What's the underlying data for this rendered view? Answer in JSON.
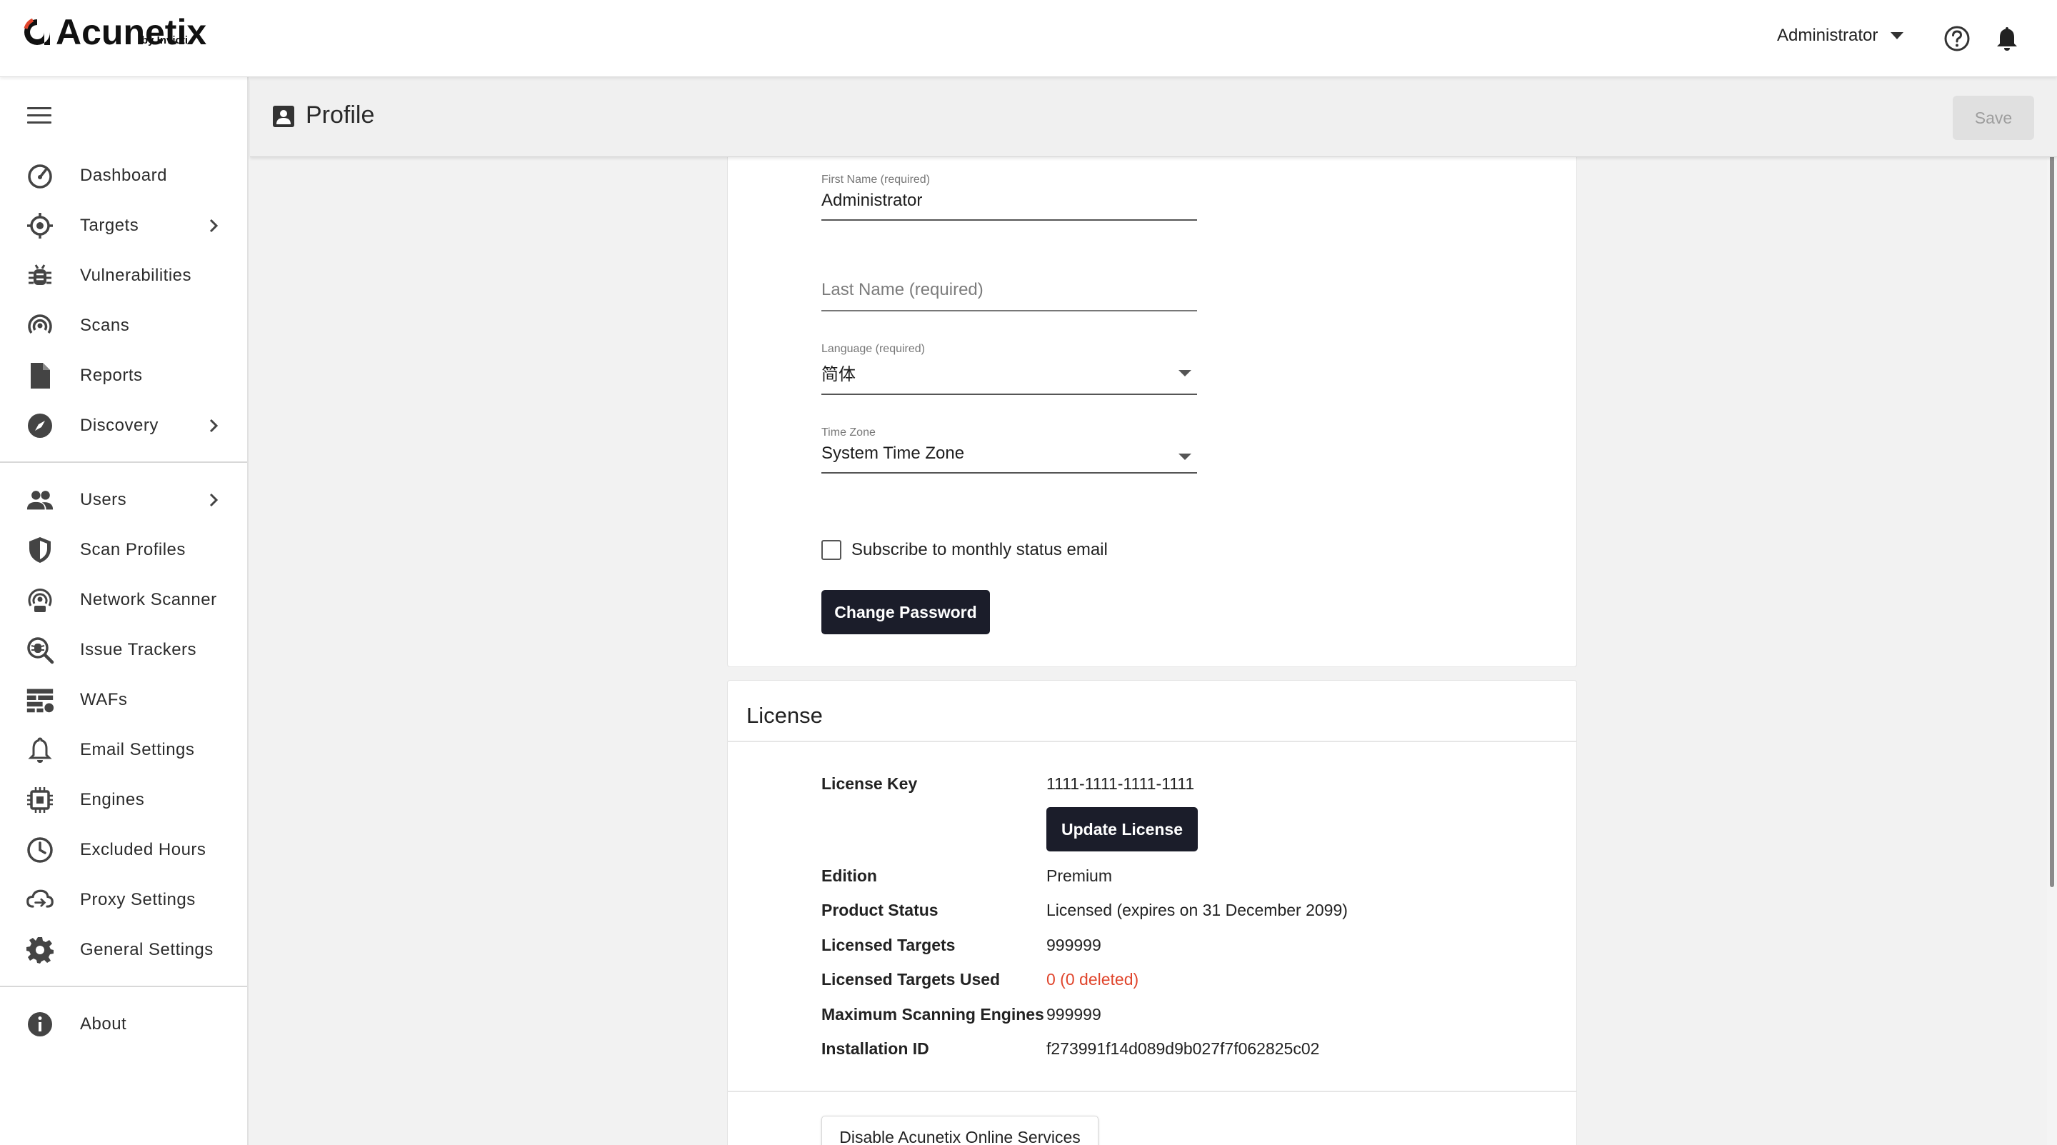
{
  "brand": {
    "name": "Acunetix",
    "sub": "by Invicti",
    "accent": "#e0452c"
  },
  "topbar": {
    "user_label": "Administrator"
  },
  "sidebar": {
    "items": [
      {
        "label": "Dashboard",
        "icon": "dashboard-icon"
      },
      {
        "label": "Targets",
        "icon": "target-icon"
      },
      {
        "label": "Vulnerabilities",
        "icon": "bug-icon"
      },
      {
        "label": "Scans",
        "icon": "scan-icon"
      },
      {
        "label": "Reports",
        "icon": "report-icon"
      },
      {
        "label": "Discovery",
        "icon": "compass-icon"
      },
      {
        "label": "Users",
        "icon": "users-icon"
      },
      {
        "label": "Scan Profiles",
        "icon": "shield-icon"
      },
      {
        "label": "Network Scanner",
        "icon": "network-scanner-icon"
      },
      {
        "label": "Issue Trackers",
        "icon": "issue-tracker-icon"
      },
      {
        "label": "WAFs",
        "icon": "waf-icon"
      },
      {
        "label": "Email Settings",
        "icon": "bell-icon"
      },
      {
        "label": "Engines",
        "icon": "chip-icon"
      },
      {
        "label": "Excluded Hours",
        "icon": "clock-icon"
      },
      {
        "label": "Proxy Settings",
        "icon": "proxy-icon"
      },
      {
        "label": "General Settings",
        "icon": "gear-icon"
      },
      {
        "label": "About",
        "icon": "info-icon"
      }
    ]
  },
  "header": {
    "title": "Profile",
    "save_label": "Save"
  },
  "profile": {
    "first_name_label": "First Name (required)",
    "first_name_value": "Administrator",
    "last_name_placeholder": "Last Name (required)",
    "language_label": "Language (required)",
    "language_value": "简体",
    "timezone_label": "Time Zone",
    "timezone_value": "System Time Zone",
    "subscribe_label": "Subscribe to monthly status email",
    "subscribe_checked": false,
    "change_password_label": "Change Password"
  },
  "license": {
    "title": "License",
    "key_label": "License Key",
    "key_value": "1111-1111-1111-1111",
    "update_label": "Update License",
    "edition_label": "Edition",
    "edition_value": "Premium",
    "status_label": "Product Status",
    "status_value": "Licensed (expires on 31 December 2099)",
    "targets_label": "Licensed Targets",
    "targets_value": "999999",
    "targets_used_label": "Licensed Targets Used",
    "targets_used_value": "0 (0 deleted)",
    "engines_label": "Maximum Scanning Engines",
    "engines_value": "999999",
    "install_label": "Installation ID",
    "install_value": "f273991f14d089d9b027f7f062825c02",
    "disable_label": "Disable Acunetix Online Services"
  }
}
